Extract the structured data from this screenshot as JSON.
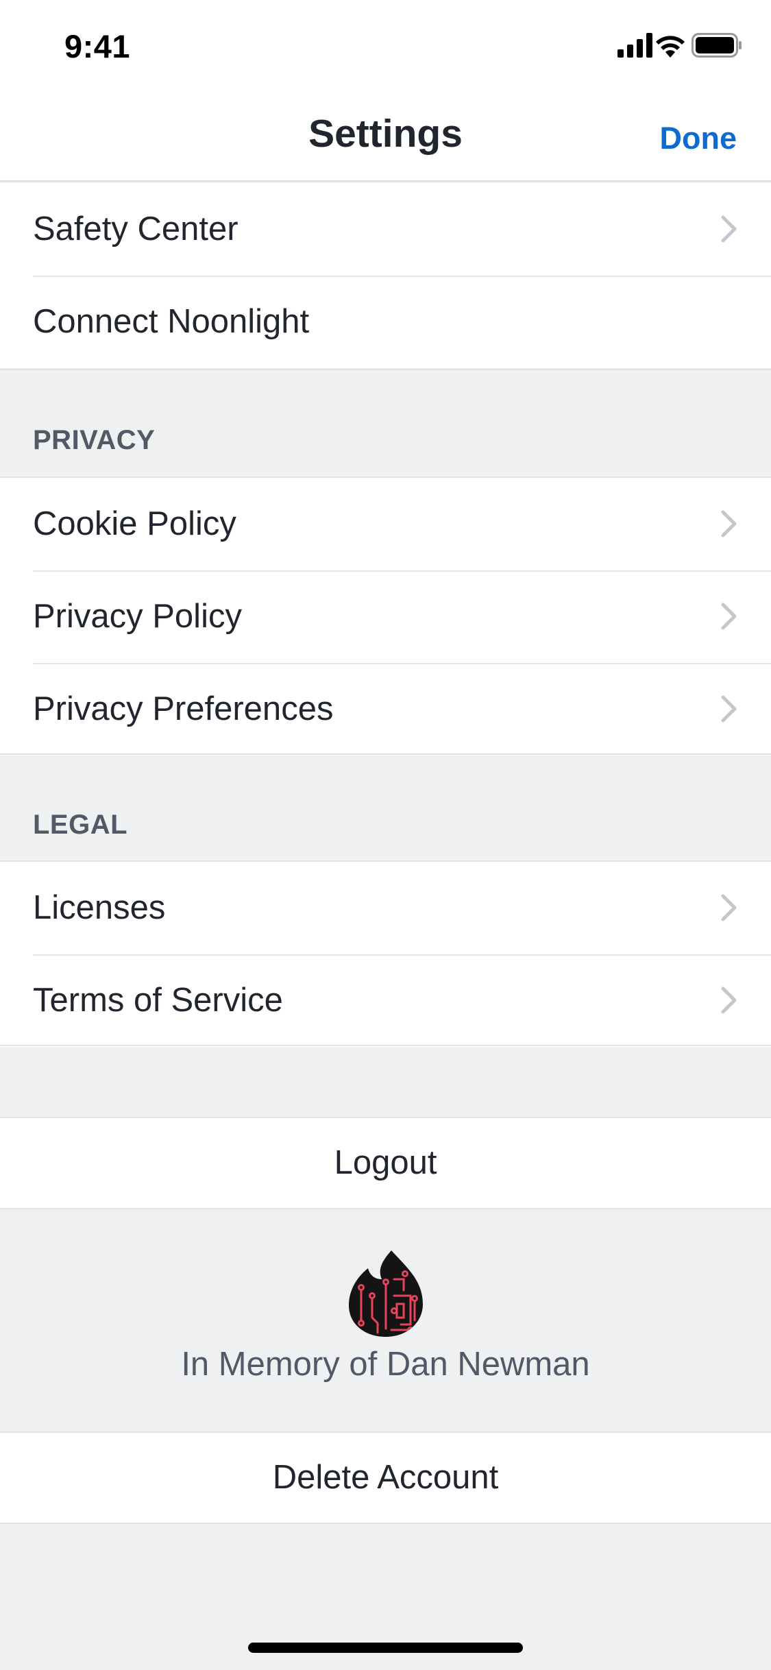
{
  "status_bar": {
    "time": "9:41"
  },
  "nav": {
    "title": "Settings",
    "done_label": "Done"
  },
  "top_group": {
    "items": [
      {
        "label": "Safety Center",
        "chevron": true
      },
      {
        "label": "Connect Noonlight",
        "chevron": false
      }
    ]
  },
  "privacy": {
    "header": "PRIVACY",
    "items": [
      {
        "label": "Cookie Policy"
      },
      {
        "label": "Privacy Policy"
      },
      {
        "label": "Privacy Preferences"
      }
    ]
  },
  "legal": {
    "header": "LEGAL",
    "items": [
      {
        "label": "Licenses"
      },
      {
        "label": "Terms of Service"
      }
    ]
  },
  "logout_label": "Logout",
  "memorial": {
    "text": "In Memory of Dan Newman",
    "logo_icon": "flame-circuit-icon"
  },
  "delete_label": "Delete Account",
  "colors": {
    "accent": "#106bd0",
    "memorial_circuit": "#e8435a",
    "background": "#eff0f2"
  }
}
